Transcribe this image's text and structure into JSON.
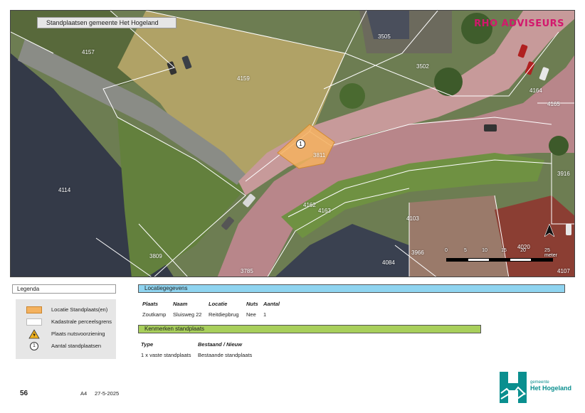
{
  "map": {
    "title": "Standplaatsen gemeente Het Hogeland",
    "brand": "RHO ADVISEURS",
    "marker_label": "1",
    "parcels": [
      "4157",
      "4159",
      "3505",
      "3502",
      "4164",
      "4165",
      "3811",
      "3916",
      "4114",
      "4162",
      "4163",
      "4103",
      "3966",
      "4084",
      "3809",
      "3785",
      "4020",
      "4107"
    ],
    "scale": {
      "ticks": [
        "0",
        "5",
        "10",
        "15",
        "20",
        "25 meter"
      ]
    }
  },
  "legend": {
    "title": "Legenda",
    "items": [
      {
        "label": "Locatie Standplaats(en)",
        "symbol": "orange-fill"
      },
      {
        "label": "Kadastrale perceelsgrens",
        "symbol": "white-fill"
      },
      {
        "label": "Plaats nutsvoorziening",
        "symbol": "warning-icon"
      },
      {
        "label": "Aantal standplaatsen",
        "symbol": "circle-number",
        "symbol_text": "1"
      }
    ]
  },
  "locatiegegevens": {
    "title": "Locatiegegevens",
    "headers": [
      "Plaats",
      "Naam",
      "Locatie",
      "Nuts",
      "Aantal"
    ],
    "row": [
      "Zoutkamp",
      "Sluisweg 22",
      "Reitdiepbrug",
      "Nee",
      "1"
    ]
  },
  "kenmerken": {
    "title": "Kenmerken standplaats",
    "headers": [
      "Type",
      "Bestaand / Nieuw"
    ],
    "row": [
      "1 x vaste standplaats",
      "Bestaande standplaats"
    ]
  },
  "footer": {
    "page_number": "56",
    "paper": "A4",
    "date": "27-5-2025",
    "logo_small": "gemeente",
    "logo_big": "Het Hogeland"
  },
  "colors": {
    "standplaats": "#f4b25f",
    "blue_bar": "#8fd4f0",
    "green_bar": "#a8cf5b",
    "brand": "#d3176d",
    "logo": "#0a8f8f"
  }
}
